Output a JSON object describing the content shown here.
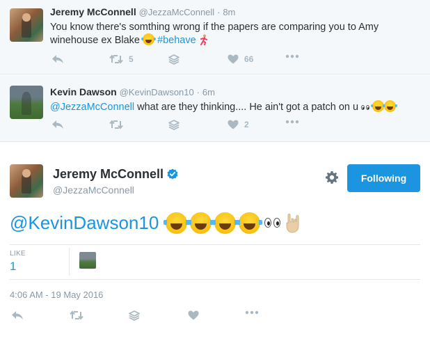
{
  "tweets": [
    {
      "name": "Jeremy McConnell",
      "handle": "@JezzaMcConnell",
      "separator": "·",
      "time": "8m",
      "text_part1": "You know there's somthing wrong if the papers are comparing you to Amy winehouse ex Blake ",
      "hashtag": "#behave",
      "retweets": "5",
      "likes": "66",
      "avatar": "jeremy-profile-photo"
    },
    {
      "name": "Kevin Dawson",
      "handle": "@KevinDawson10",
      "separator": "·",
      "time": "6m",
      "mention": "@JezzaMcConnell",
      "text_rest": " what are they thinking.... He ain't got a patch on u ",
      "retweets": "",
      "likes": "2",
      "avatar": "kevin-profile-photo"
    }
  ],
  "main_tweet": {
    "name": "Jeremy McConnell",
    "handle": "@JezzaMcConnell",
    "verified": true,
    "follow_button": "Following",
    "mention": "@KevinDawson10",
    "emojis": [
      "face-with-tears-of-joy",
      "face-with-tears-of-joy",
      "face-with-tears-of-joy",
      "face-with-tears-of-joy",
      "eyes",
      "sign-of-the-horns"
    ],
    "like_label": "LIKE",
    "like_count": "1",
    "date": "4:06 AM - 19 May 2016"
  },
  "icons": [
    "reply-icon",
    "retweet-icon",
    "stack-icon",
    "heart-icon",
    "more-icon",
    "gear-icon",
    "verified-icon"
  ],
  "colors": {
    "accent": "#1b95e0",
    "muted": "#8899a6",
    "icon_gray": "#aab8c2",
    "reply_bg": "#f5f8fa",
    "border": "#e1e8ed"
  }
}
